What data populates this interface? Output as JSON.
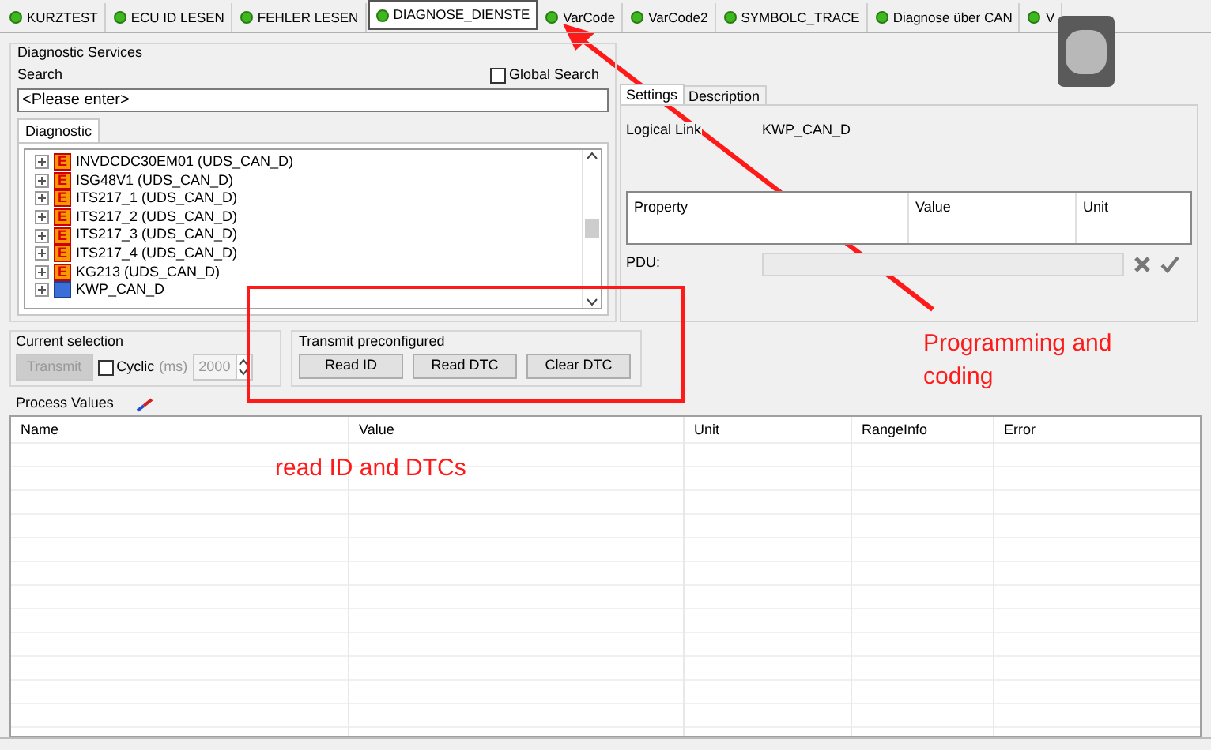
{
  "tabs": [
    {
      "label": "KURZTEST",
      "selected": false
    },
    {
      "label": "ECU ID LESEN",
      "selected": false
    },
    {
      "label": "FEHLER LESEN",
      "selected": false
    },
    {
      "label": "DIAGNOSE_DIENSTE",
      "selected": true
    },
    {
      "label": "VarCode",
      "selected": false
    },
    {
      "label": "VarCode2",
      "selected": false
    },
    {
      "label": "SYMBOLC_TRACE",
      "selected": false
    },
    {
      "label": "Diagnose über CAN",
      "selected": false
    },
    {
      "label": "V",
      "selected": false
    }
  ],
  "diagnostic_services": {
    "title": "Diagnostic Services",
    "search_label": "Search",
    "global_search": {
      "label": "Global Search",
      "checked": false
    },
    "search_field": {
      "value": "<Please enter>"
    },
    "list_tab": "Diagnostic",
    "items": [
      {
        "label": "INVDCDC30EM01 (UDS_CAN_D)",
        "kind": "ecu",
        "icon": "E"
      },
      {
        "label": "ISG48V1 (UDS_CAN_D)",
        "kind": "ecu",
        "icon": "E"
      },
      {
        "label": "ITS217_1 (UDS_CAN_D)",
        "kind": "ecu",
        "icon": "E"
      },
      {
        "label": "ITS217_2 (UDS_CAN_D)",
        "kind": "ecu",
        "icon": "E"
      },
      {
        "label": "ITS217_3 (UDS_CAN_D)",
        "kind": "ecu",
        "icon": "E"
      },
      {
        "label": "ITS217_4 (UDS_CAN_D)",
        "kind": "ecu",
        "icon": "E"
      },
      {
        "label": "KG213 (UDS_CAN_D)",
        "kind": "ecu",
        "icon": "E"
      },
      {
        "label": "KWP_CAN_D",
        "kind": "link"
      }
    ]
  },
  "details": {
    "tabs": [
      {
        "label": "Settings",
        "selected": true
      },
      {
        "label": "Description",
        "selected": false
      }
    ],
    "logical_link_label": "Logical Link",
    "logical_link_value": "KWP_CAN_D",
    "columns": [
      "Property",
      "Value",
      "Unit"
    ],
    "pdu_label": "PDU:"
  },
  "current_selection": {
    "title": "Current selection",
    "transmit": {
      "label": "Transmit",
      "disabled": true
    },
    "cyclic": {
      "label": "Cyclic",
      "checked": false
    },
    "unit": "(ms)",
    "interval": "2000"
  },
  "transmit_preconfigured": {
    "title": "Transmit preconfigured",
    "buttons": [
      "Read ID",
      "Read DTC",
      "Clear DTC"
    ]
  },
  "process_values": {
    "title": "Process Values",
    "columns": [
      "Name",
      "Value",
      "Unit",
      "RangeInfo",
      "Error"
    ]
  },
  "annotations": [
    "Programming and coding",
    "read ID and DTCs"
  ]
}
